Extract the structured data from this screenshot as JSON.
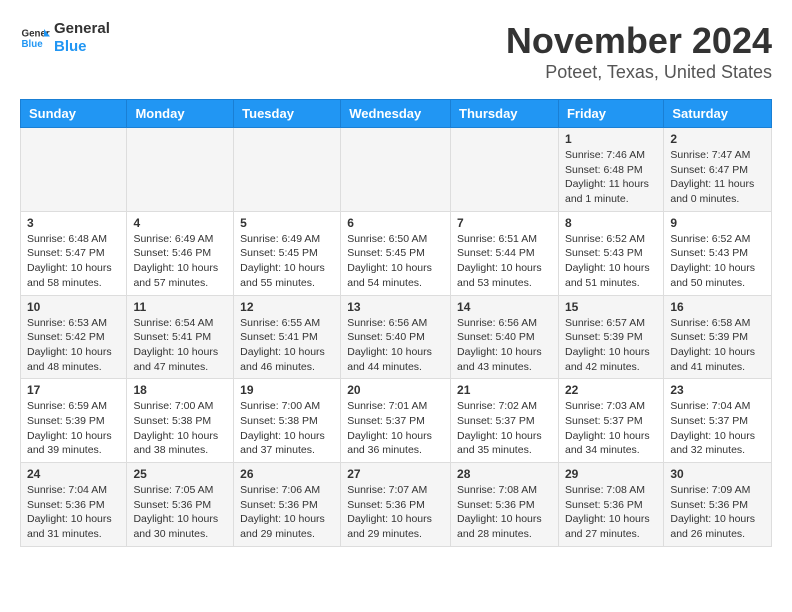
{
  "header": {
    "logo_line1": "General",
    "logo_line2": "Blue",
    "month_title": "November 2024",
    "location": "Poteet, Texas, United States"
  },
  "calendar": {
    "weekdays": [
      "Sunday",
      "Monday",
      "Tuesday",
      "Wednesday",
      "Thursday",
      "Friday",
      "Saturday"
    ],
    "weeks": [
      [
        {
          "day": "",
          "info": ""
        },
        {
          "day": "",
          "info": ""
        },
        {
          "day": "",
          "info": ""
        },
        {
          "day": "",
          "info": ""
        },
        {
          "day": "",
          "info": ""
        },
        {
          "day": "1",
          "info": "Sunrise: 7:46 AM\nSunset: 6:48 PM\nDaylight: 11 hours and 1 minute."
        },
        {
          "day": "2",
          "info": "Sunrise: 7:47 AM\nSunset: 6:47 PM\nDaylight: 11 hours and 0 minutes."
        }
      ],
      [
        {
          "day": "3",
          "info": "Sunrise: 6:48 AM\nSunset: 5:47 PM\nDaylight: 10 hours and 58 minutes."
        },
        {
          "day": "4",
          "info": "Sunrise: 6:49 AM\nSunset: 5:46 PM\nDaylight: 10 hours and 57 minutes."
        },
        {
          "day": "5",
          "info": "Sunrise: 6:49 AM\nSunset: 5:45 PM\nDaylight: 10 hours and 55 minutes."
        },
        {
          "day": "6",
          "info": "Sunrise: 6:50 AM\nSunset: 5:45 PM\nDaylight: 10 hours and 54 minutes."
        },
        {
          "day": "7",
          "info": "Sunrise: 6:51 AM\nSunset: 5:44 PM\nDaylight: 10 hours and 53 minutes."
        },
        {
          "day": "8",
          "info": "Sunrise: 6:52 AM\nSunset: 5:43 PM\nDaylight: 10 hours and 51 minutes."
        },
        {
          "day": "9",
          "info": "Sunrise: 6:52 AM\nSunset: 5:43 PM\nDaylight: 10 hours and 50 minutes."
        }
      ],
      [
        {
          "day": "10",
          "info": "Sunrise: 6:53 AM\nSunset: 5:42 PM\nDaylight: 10 hours and 48 minutes."
        },
        {
          "day": "11",
          "info": "Sunrise: 6:54 AM\nSunset: 5:41 PM\nDaylight: 10 hours and 47 minutes."
        },
        {
          "day": "12",
          "info": "Sunrise: 6:55 AM\nSunset: 5:41 PM\nDaylight: 10 hours and 46 minutes."
        },
        {
          "day": "13",
          "info": "Sunrise: 6:56 AM\nSunset: 5:40 PM\nDaylight: 10 hours and 44 minutes."
        },
        {
          "day": "14",
          "info": "Sunrise: 6:56 AM\nSunset: 5:40 PM\nDaylight: 10 hours and 43 minutes."
        },
        {
          "day": "15",
          "info": "Sunrise: 6:57 AM\nSunset: 5:39 PM\nDaylight: 10 hours and 42 minutes."
        },
        {
          "day": "16",
          "info": "Sunrise: 6:58 AM\nSunset: 5:39 PM\nDaylight: 10 hours and 41 minutes."
        }
      ],
      [
        {
          "day": "17",
          "info": "Sunrise: 6:59 AM\nSunset: 5:39 PM\nDaylight: 10 hours and 39 minutes."
        },
        {
          "day": "18",
          "info": "Sunrise: 7:00 AM\nSunset: 5:38 PM\nDaylight: 10 hours and 38 minutes."
        },
        {
          "day": "19",
          "info": "Sunrise: 7:00 AM\nSunset: 5:38 PM\nDaylight: 10 hours and 37 minutes."
        },
        {
          "day": "20",
          "info": "Sunrise: 7:01 AM\nSunset: 5:37 PM\nDaylight: 10 hours and 36 minutes."
        },
        {
          "day": "21",
          "info": "Sunrise: 7:02 AM\nSunset: 5:37 PM\nDaylight: 10 hours and 35 minutes."
        },
        {
          "day": "22",
          "info": "Sunrise: 7:03 AM\nSunset: 5:37 PM\nDaylight: 10 hours and 34 minutes."
        },
        {
          "day": "23",
          "info": "Sunrise: 7:04 AM\nSunset: 5:37 PM\nDaylight: 10 hours and 32 minutes."
        }
      ],
      [
        {
          "day": "24",
          "info": "Sunrise: 7:04 AM\nSunset: 5:36 PM\nDaylight: 10 hours and 31 minutes."
        },
        {
          "day": "25",
          "info": "Sunrise: 7:05 AM\nSunset: 5:36 PM\nDaylight: 10 hours and 30 minutes."
        },
        {
          "day": "26",
          "info": "Sunrise: 7:06 AM\nSunset: 5:36 PM\nDaylight: 10 hours and 29 minutes."
        },
        {
          "day": "27",
          "info": "Sunrise: 7:07 AM\nSunset: 5:36 PM\nDaylight: 10 hours and 29 minutes."
        },
        {
          "day": "28",
          "info": "Sunrise: 7:08 AM\nSunset: 5:36 PM\nDaylight: 10 hours and 28 minutes."
        },
        {
          "day": "29",
          "info": "Sunrise: 7:08 AM\nSunset: 5:36 PM\nDaylight: 10 hours and 27 minutes."
        },
        {
          "day": "30",
          "info": "Sunrise: 7:09 AM\nSunset: 5:36 PM\nDaylight: 10 hours and 26 minutes."
        }
      ]
    ]
  }
}
